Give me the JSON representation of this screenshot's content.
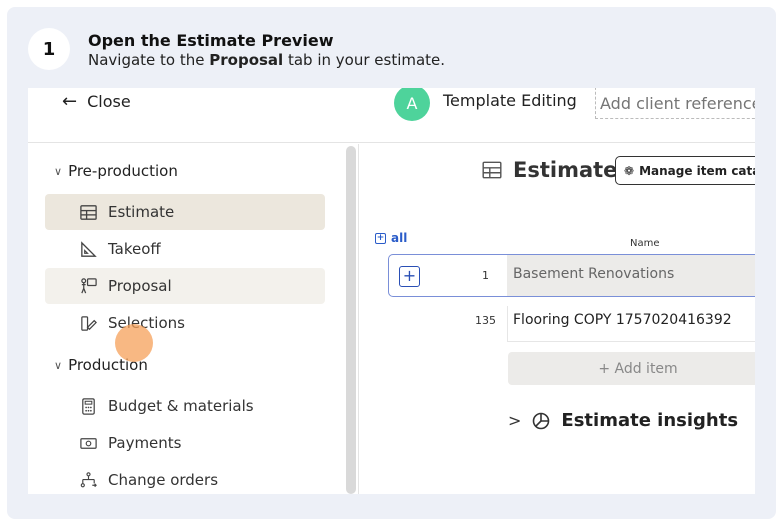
{
  "step": {
    "number": "1",
    "title": "Open the Estimate Preview",
    "desc_prefix": "Navigate to the ",
    "desc_bold": "Proposal",
    "desc_suffix": " tab in your estimate."
  },
  "topbar": {
    "close_label": "Close",
    "avatar_letter": "A",
    "project_title": "Template Editing",
    "client_placeholder": "Add client reference"
  },
  "sidebar": {
    "sections": [
      {
        "label": "Pre-production",
        "items": [
          {
            "label": "Estimate",
            "icon": "table-icon",
            "active": true
          },
          {
            "label": "Takeoff",
            "icon": "ruler-icon"
          },
          {
            "label": "Proposal",
            "icon": "proposal-icon",
            "hover": true
          },
          {
            "label": "Selections",
            "icon": "selections-icon"
          }
        ]
      },
      {
        "label": "Production",
        "items": [
          {
            "label": "Budget & materials",
            "icon": "calculator-icon"
          },
          {
            "label": "Payments",
            "icon": "money-icon"
          },
          {
            "label": "Change orders",
            "icon": "flow-icon"
          }
        ]
      }
    ]
  },
  "main": {
    "title": "Estimate",
    "manage_button": "Manage item catalog",
    "all_label": "all",
    "column_name": "Name",
    "rows": [
      {
        "num": "1",
        "name": "Basement Renovations"
      },
      {
        "num": "135",
        "name": "Flooring COPY 1757020416392"
      }
    ],
    "add_item_label": "+ Add item",
    "insights_label": "Estimate insights"
  },
  "colors": {
    "accent_green": "#4ed39b",
    "active_nav": "#ece7dd",
    "click_indicator": "#f5a05a",
    "link_blue": "#2a5cc9"
  }
}
